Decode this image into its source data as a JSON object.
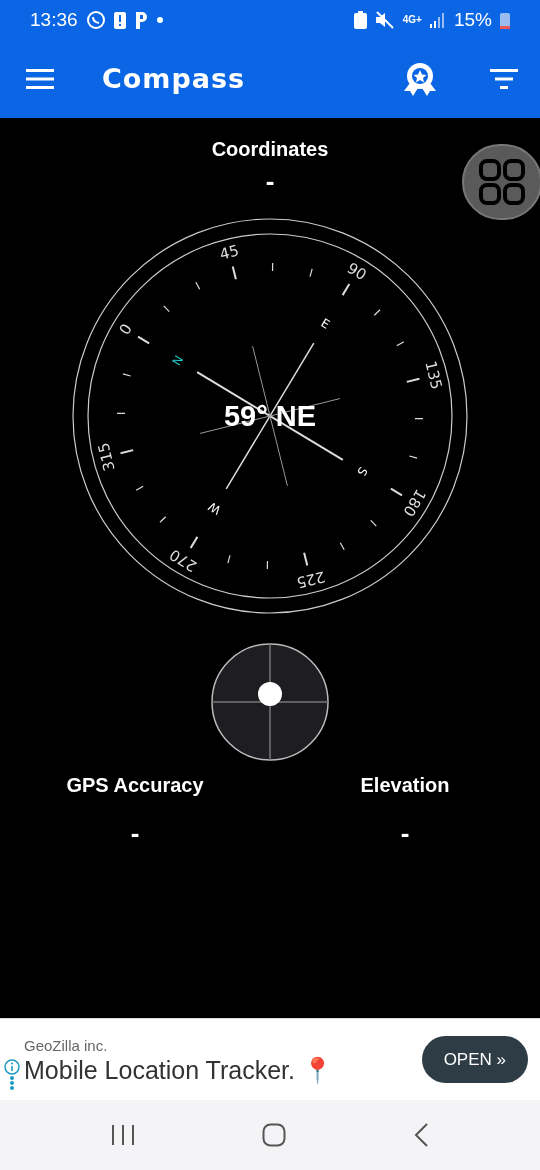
{
  "status_bar": {
    "time": "13:36",
    "network": "4G+",
    "battery": "15%"
  },
  "app_bar": {
    "title": "Compass"
  },
  "coordinates": {
    "label": "Coordinates",
    "value": "-"
  },
  "compass": {
    "heading": "59° NE",
    "dial_labels": [
      "0",
      "45",
      "90",
      "135",
      "180",
      "225",
      "270",
      "315"
    ],
    "cardinals": [
      {
        "letter": "N",
        "color": "#21c4c4"
      },
      {
        "letter": "E",
        "color": "#ffffff"
      },
      {
        "letter": "S",
        "color": "#ffffff"
      },
      {
        "letter": "W",
        "color": "#ffffff"
      }
    ]
  },
  "readings": [
    {
      "label": "GPS Accuracy",
      "value": "-"
    },
    {
      "label": "Elevation",
      "value": "-"
    }
  ],
  "ad": {
    "advertiser": "GeoZilla inc.",
    "headline": "Mobile Location Tracker. 📍",
    "button": "OPEN »"
  }
}
